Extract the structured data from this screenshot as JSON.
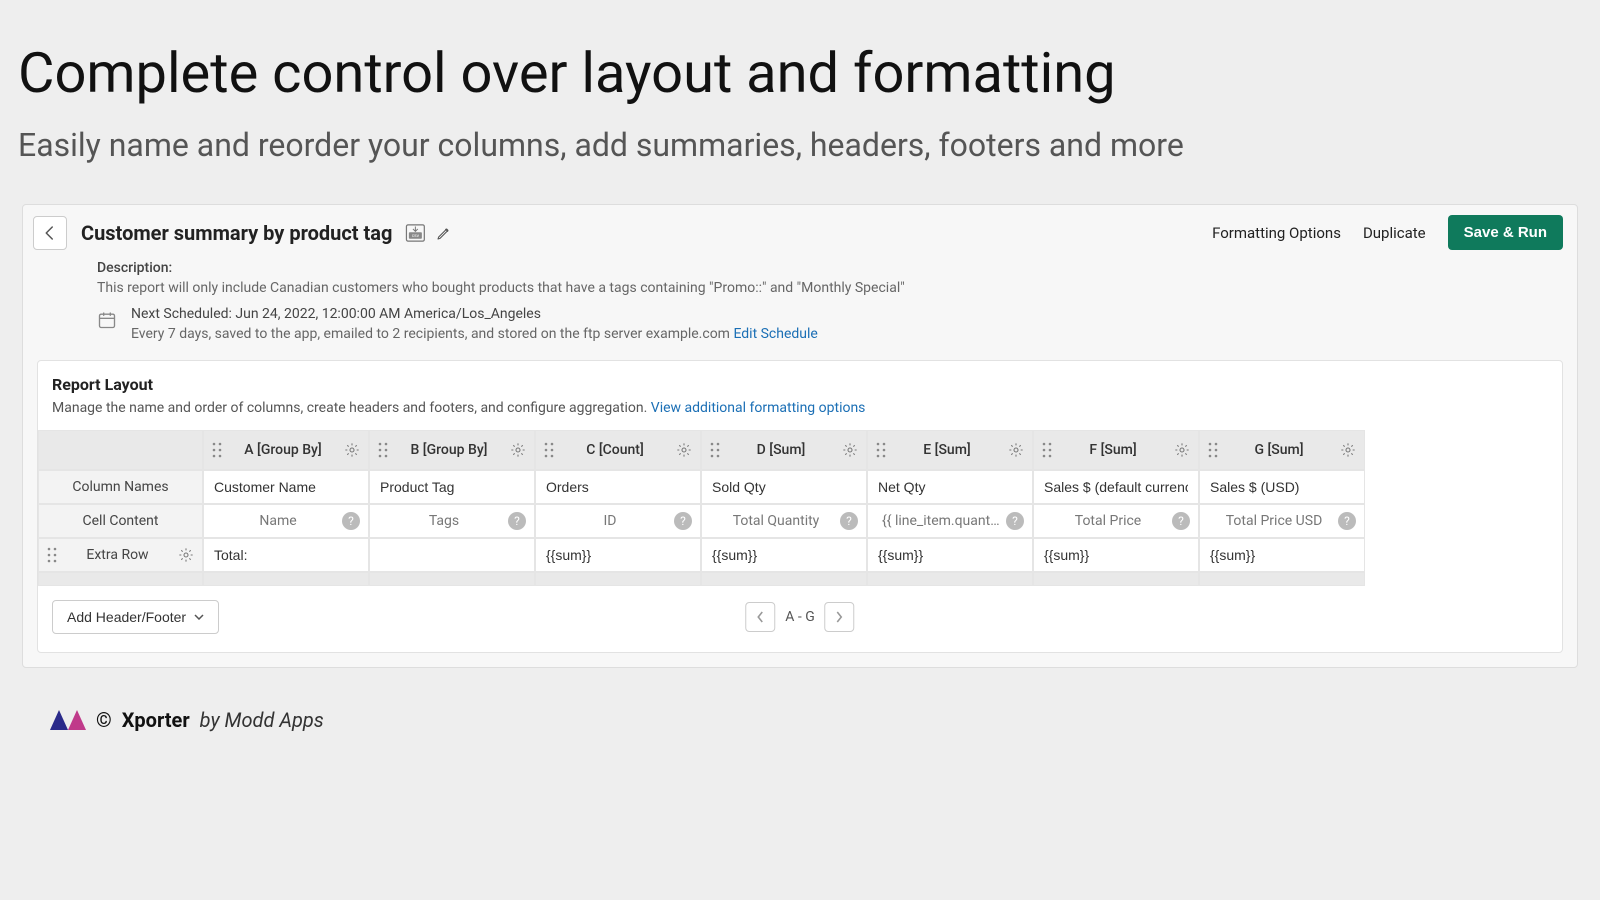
{
  "page": {
    "title": "Complete control over layout and formatting",
    "subtitle": "Easily name and reorder your columns, add summaries, headers, footers and more"
  },
  "header": {
    "report_title": "Customer summary by product tag",
    "formatting_options": "Formatting Options",
    "duplicate": "Duplicate",
    "save_run": "Save & Run"
  },
  "meta": {
    "desc_label": "Description:",
    "desc_text": "This report will only include Canadian customers who bought products that have a tags containing \"Promo::\" and \"Monthly Special\"",
    "sched_line1": "Next Scheduled: Jun 24, 2022, 12:00:00 AM America/Los_Angeles",
    "sched_line2": "Every 7 days, saved to the app, emailed to 2 recipients, and stored on the ftp server example.com ",
    "edit_schedule": "Edit Schedule"
  },
  "panel": {
    "title": "Report Layout",
    "subtitle_text": "Manage the name and order of columns, create headers and footers, and configure aggregation. ",
    "subtitle_link": "View additional formatting options"
  },
  "grid": {
    "row_labels": {
      "column_names": "Column Names",
      "cell_content": "Cell Content",
      "extra_row": "Extra Row"
    },
    "columns": [
      {
        "head": "A [Group By]",
        "name": "Customer Name",
        "content": "Name",
        "extra": "Total:"
      },
      {
        "head": "B [Group By]",
        "name": "Product Tag",
        "content": "Tags",
        "extra": ""
      },
      {
        "head": "C [Count]",
        "name": "Orders",
        "content": "ID",
        "extra": "{{sum}}"
      },
      {
        "head": "D [Sum]",
        "name": "Sold Qty",
        "content": "Total Quantity",
        "extra": "{{sum}}"
      },
      {
        "head": "E [Sum]",
        "name": "Net Qty",
        "content": "{{ line_item.quantity * line_it",
        "extra": "{{sum}}"
      },
      {
        "head": "F [Sum]",
        "name": "Sales $ (default currency)",
        "content": "Total Price",
        "extra": "{{sum}}"
      },
      {
        "head": "G [Sum]",
        "name": "Sales $ (USD)",
        "content": "Total Price USD",
        "extra": "{{sum}}"
      }
    ]
  },
  "bottom": {
    "add_hf": "Add Header/Footer",
    "page_label": "A - G"
  },
  "footer": {
    "copyright": "©",
    "name": "Xporter",
    "by": "by Modd Apps"
  }
}
